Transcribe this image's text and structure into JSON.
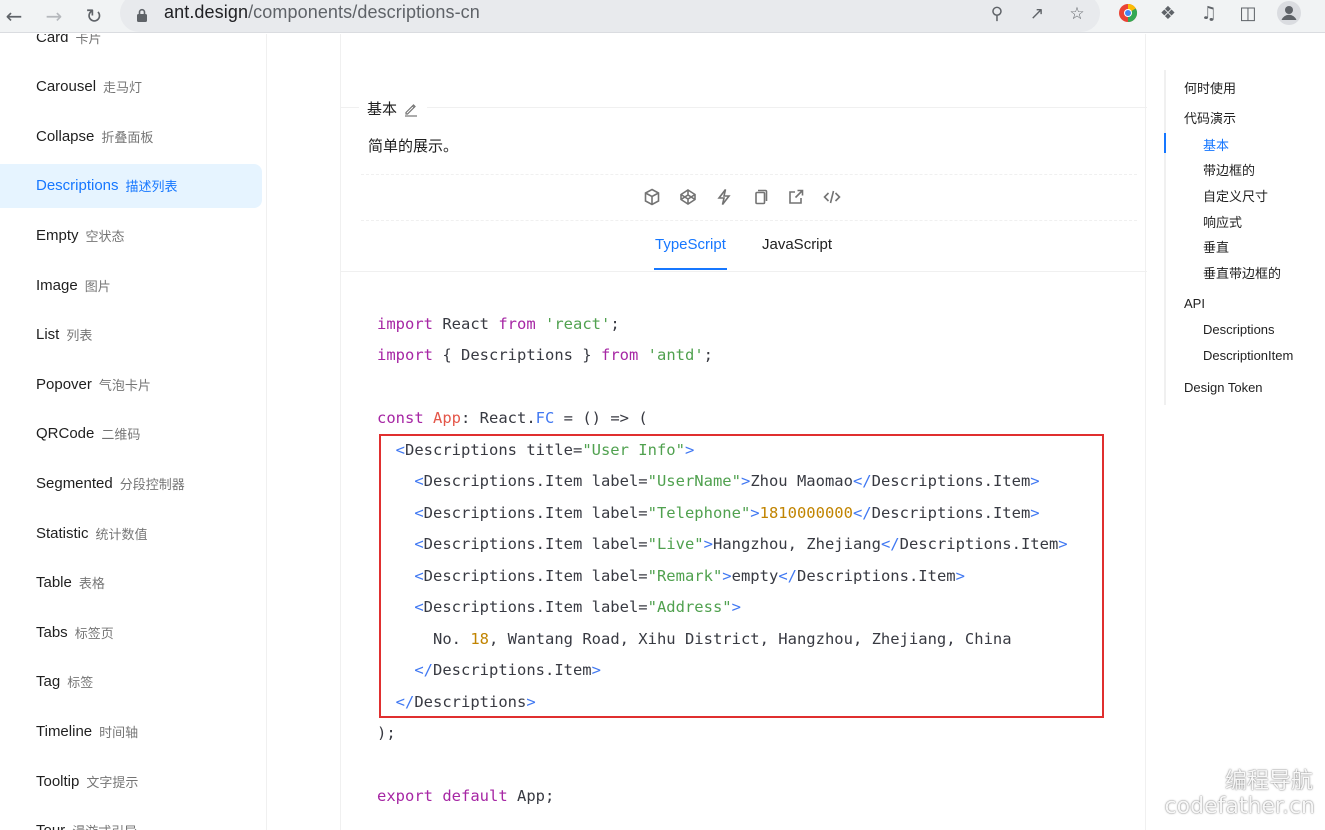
{
  "browser": {
    "url_host": "ant.design",
    "url_path": "/components/descriptions-cn",
    "icons": [
      "back-icon",
      "forward-icon",
      "reload-icon",
      "lock-icon",
      "zoom-icon",
      "share-icon",
      "bookmark-star-icon",
      "chrome-extension-icon",
      "puzzle-icon",
      "media-icon",
      "sidepanel-icon",
      "profile-icon"
    ]
  },
  "sidebar": {
    "items": [
      {
        "label": "Card",
        "sub": "卡片"
      },
      {
        "label": "Carousel",
        "sub": "走马灯"
      },
      {
        "label": "Collapse",
        "sub": "折叠面板"
      },
      {
        "label": "Descriptions",
        "sub": "描述列表",
        "active": true
      },
      {
        "label": "Empty",
        "sub": "空状态"
      },
      {
        "label": "Image",
        "sub": "图片"
      },
      {
        "label": "List",
        "sub": "列表"
      },
      {
        "label": "Popover",
        "sub": "气泡卡片"
      },
      {
        "label": "QRCode",
        "sub": "二维码"
      },
      {
        "label": "Segmented",
        "sub": "分段控制器"
      },
      {
        "label": "Statistic",
        "sub": "统计数值"
      },
      {
        "label": "Table",
        "sub": "表格"
      },
      {
        "label": "Tabs",
        "sub": "标签页"
      },
      {
        "label": "Tag",
        "sub": "标签"
      },
      {
        "label": "Timeline",
        "sub": "时间轴"
      },
      {
        "label": "Tooltip",
        "sub": "文字提示"
      },
      {
        "label": "Tour",
        "sub": "漫游式引导"
      }
    ]
  },
  "demo": {
    "title": "基本",
    "description": "简单的展示。",
    "tabs": [
      "TypeScript",
      "JavaScript"
    ],
    "active_tab": "TypeScript",
    "actions": [
      "codesandbox-icon",
      "codepen-icon",
      "stackblitz-icon",
      "copy-icon",
      "open-new-window-icon",
      "code-expand-icon"
    ],
    "code": {
      "l1": {
        "k1": "import",
        "t1": " React ",
        "k2": "from",
        "s1": "'react'",
        "p1": ";"
      },
      "l2": {
        "k1": "import",
        "t1": " { Descriptions } ",
        "k2": "from",
        "s1": "'antd'",
        "p1": ";"
      },
      "l3": {
        "k1": "const",
        "f1": "App",
        "t1": ": React.",
        "ty1": "FC",
        "t2": " = () => ("
      },
      "l4": {
        "t1": "  <",
        "n1": "Descriptions",
        "a1": " title=",
        "s1": "\"User Info\"",
        "t2": ">"
      },
      "l5": {
        "t1": "    <",
        "n1": "Descriptions.Item",
        "a1": " label=",
        "s1": "\"UserName\"",
        "t2": ">",
        "c1": "Zhou Maomao",
        "t3": "</",
        "n2": "Descriptions.Item",
        "t4": ">"
      },
      "l6": {
        "t1": "    <",
        "n1": "Descriptions.Item",
        "a1": " label=",
        "s1": "\"Telephone\"",
        "t2": ">",
        "c1": "1810000000",
        "t3": "</",
        "n2": "Descriptions.Item",
        "t4": ">"
      },
      "l7": {
        "t1": "    <",
        "n1": "Descriptions.Item",
        "a1": " label=",
        "s1": "\"Live\"",
        "t2": ">",
        "c1": "Hangzhou, Zhejiang",
        "t3": "</",
        "n2": "Descriptions.Item",
        "t4": ">"
      },
      "l8": {
        "t1": "    <",
        "n1": "Descriptions.Item",
        "a1": " label=",
        "s1": "\"Remark\"",
        "t2": ">",
        "c1": "empty",
        "t3": "</",
        "n2": "Descriptions.Item",
        "t4": ">"
      },
      "l9": {
        "t1": "    <",
        "n1": "Descriptions.Item",
        "a1": " label=",
        "s1": "\"Address\"",
        "t2": ">"
      },
      "l10": {
        "c1": "      No. ",
        "num": "18",
        "c2": ", Wantang Road, Xihu District, Hangzhou, Zhejiang, China"
      },
      "l11": {
        "t1": "    </",
        "n1": "Descriptions.Item",
        "t2": ">"
      },
      "l12": {
        "t1": "  </",
        "n1": "Descriptions",
        "t2": ">"
      },
      "l13": {
        "t1": ");"
      },
      "l14": {
        "k1": "export",
        "k2": " default",
        "t1": " App;"
      }
    }
  },
  "anchor": {
    "items": [
      {
        "label": "何时使用",
        "level": 1
      },
      {
        "label": "代码演示",
        "level": 1
      },
      {
        "label": "基本",
        "level": 2,
        "active": true
      },
      {
        "label": "带边框的",
        "level": 2
      },
      {
        "label": "自定义尺寸",
        "level": 2
      },
      {
        "label": "响应式",
        "level": 2
      },
      {
        "label": "垂直",
        "level": 2
      },
      {
        "label": "垂直带边框的",
        "level": 2
      },
      {
        "label": "API",
        "level": 1
      },
      {
        "label": "Descriptions",
        "level": 2
      },
      {
        "label": "DescriptionItem",
        "level": 2
      },
      {
        "label": "Design Token",
        "level": 1
      }
    ]
  },
  "watermark": {
    "line1": "编程导航",
    "line2": "codefather.cn"
  },
  "colors": {
    "accent": "#1677ff",
    "active_bg": "#e6f4ff",
    "highlight_box": "#e02f2f",
    "keyword": "#a626a4",
    "string": "#50a14f"
  }
}
